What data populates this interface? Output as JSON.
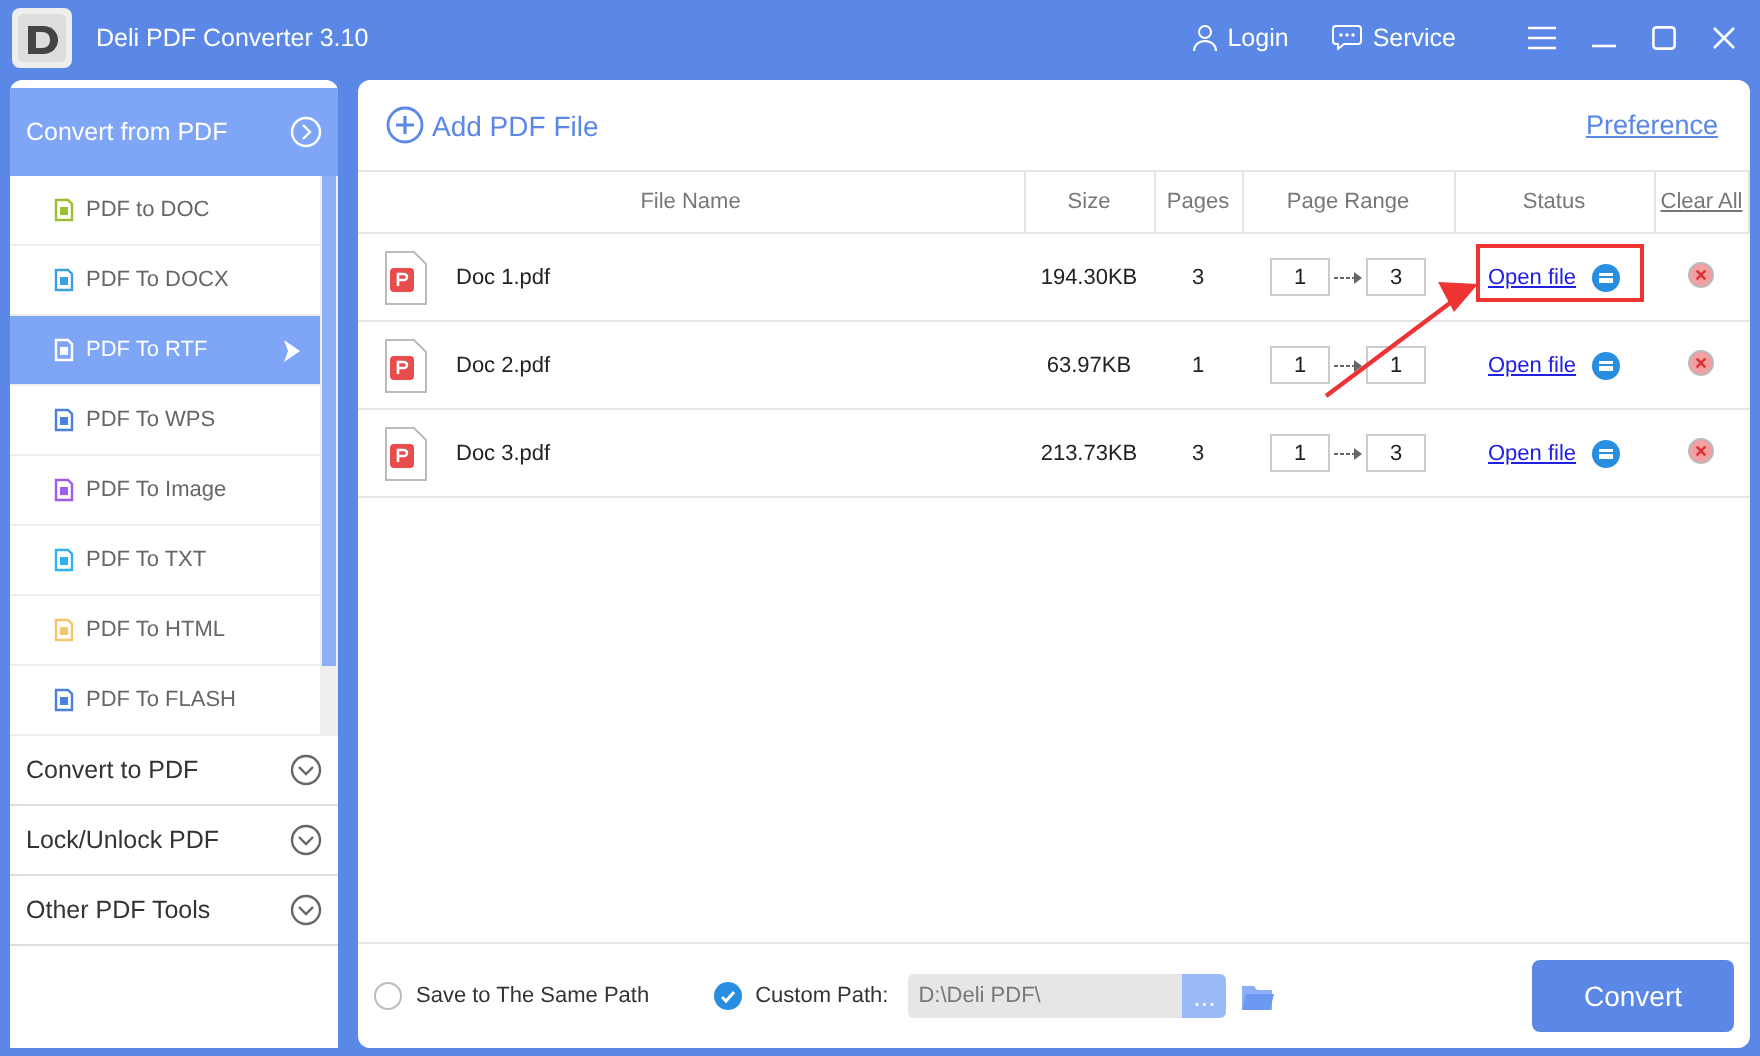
{
  "window": {
    "title": "Deli PDF Converter 3.10",
    "login": "Login",
    "service": "Service"
  },
  "sidebar": {
    "header": {
      "label": "Convert from PDF",
      "expanded": true
    },
    "items": [
      {
        "label": "PDF to DOC",
        "color": "#9bbf2e",
        "selected": false
      },
      {
        "label": "PDF To DOCX",
        "color": "#3aa0e0",
        "selected": false
      },
      {
        "label": "PDF To RTF",
        "color": "#ffffff",
        "selected": true
      },
      {
        "label": "PDF To WPS",
        "color": "#4a7fe0",
        "selected": false
      },
      {
        "label": "PDF To Image",
        "color": "#a05ce8",
        "selected": false
      },
      {
        "label": "PDF To TXT",
        "color": "#2fb0f0",
        "selected": false
      },
      {
        "label": "PDF To HTML",
        "color": "#f5c46a",
        "selected": false
      },
      {
        "label": "PDF To FLASH",
        "color": "#4a7fe0",
        "selected": false
      }
    ],
    "sections": [
      {
        "label": "Convert to PDF",
        "expanded": false
      },
      {
        "label": "Lock/Unlock PDF",
        "expanded": false
      },
      {
        "label": "Other PDF Tools",
        "expanded": false
      }
    ]
  },
  "toolbar": {
    "add": "Add PDF File",
    "preference": "Preference"
  },
  "table": {
    "columns": [
      "File Name",
      "Size",
      "Pages",
      "Page Range",
      "Status"
    ],
    "clear_all": "Clear All",
    "rows": [
      {
        "name": "Doc 1.pdf",
        "size": "194.30KB",
        "pages": "3",
        "from": "1",
        "to": "3",
        "status": "Open file",
        "annotated": true
      },
      {
        "name": "Doc 2.pdf",
        "size": "63.97KB",
        "pages": "1",
        "from": "1",
        "to": "1",
        "status": "Open file",
        "annotated": false
      },
      {
        "name": "Doc 3.pdf",
        "size": "213.73KB",
        "pages": "3",
        "from": "1",
        "to": "3",
        "status": "Open file",
        "annotated": false
      }
    ]
  },
  "footer": {
    "same_path": {
      "label": "Save to The Same Path",
      "selected": false
    },
    "custom_path": {
      "label": "Custom Path:",
      "selected": true
    },
    "path": "D:\\Deli PDF\\",
    "browse": "...",
    "convert": "Convert"
  }
}
